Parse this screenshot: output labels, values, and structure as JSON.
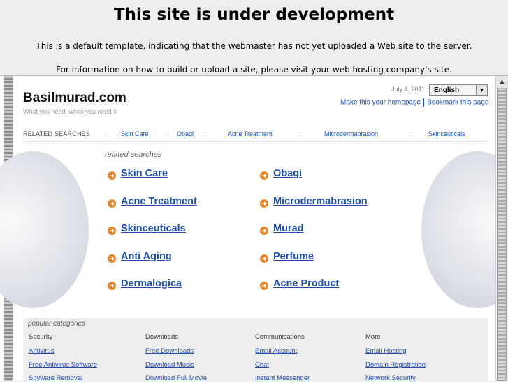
{
  "header": {
    "title": "This site is under development",
    "line1": "This is a default template, indicating that the webmaster has not yet uploaded a Web site to the server.",
    "line2": "For information on how to build or upload a site, please visit your web hosting company's site."
  },
  "site": {
    "name": "Basilmurad.com",
    "tagline": "What you need, when you need it",
    "date": "July 4, 2011",
    "language": "English",
    "make_homepage": "Make this your homepage",
    "bookmark": "Bookmark this page"
  },
  "related_bar": {
    "label": "RELATED SEARCHES",
    "separator": "::",
    "items": [
      "Skin Care",
      "Obagi",
      "Acne Treatment",
      "Microdermabrasion",
      "Skinceuticals"
    ]
  },
  "related_main": {
    "title": "related searches",
    "links": [
      "Skin Care",
      "Obagi",
      "Acne Treatment",
      "Microdermabrasion",
      "Skinceuticals",
      "Murad",
      "Anti Aging",
      "Perfume",
      "Dermalogica",
      "Acne Product"
    ]
  },
  "popular": {
    "title": "popular categories",
    "columns": [
      {
        "heading": "Security",
        "links": [
          "Antivirus",
          "Free Antivirus Software",
          "Spyware Removal"
        ]
      },
      {
        "heading": "Downloads",
        "links": [
          "Free Downloads",
          "Download Music",
          "Download Full Movie"
        ]
      },
      {
        "heading": "Communications",
        "links": [
          "Email Account",
          "Chat",
          "Instant Messenger"
        ]
      },
      {
        "heading": "More",
        "links": [
          "Email Hosting",
          "Domain Registration",
          "Network Security"
        ]
      }
    ]
  },
  "icons": {
    "bullet": "arrow-circle-icon",
    "dropdown": "chevron-down-icon",
    "scroll_up": "arrow-up-icon"
  },
  "colors": {
    "link": "#1f4fa8",
    "bullet": "#e8872a",
    "page_bg": "#eeeeee"
  }
}
